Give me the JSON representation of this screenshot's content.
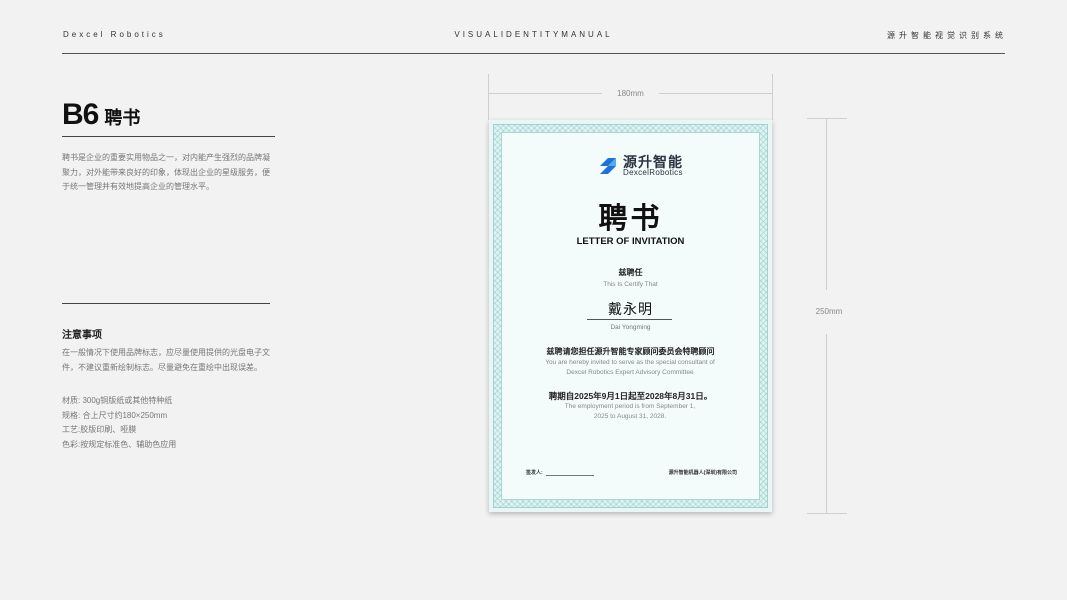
{
  "header": {
    "brand": "Dexcel Robotics",
    "manual": "VISUALIDENTITYMANUAL",
    "system": "源升智能视觉识别系统"
  },
  "section": {
    "code": "B6",
    "title": "聘书",
    "description": "聘书是企业的重要实用物品之一，对内能产生强烈的品牌凝聚力，对外能带来良好的印象，体现出企业的星级服务，便于统一管理并有效地提高企业的管理水平。"
  },
  "notes": {
    "title": "注意事项",
    "text": "在一般情况下使用品牌标志，应尽量使用提供的光盘电子文件，不建议重新绘制标志。尽量避免在重绘中出现误差。"
  },
  "specs": [
    "材质: 300g铜版纸或其他特种纸",
    "规格: 合上尺寸约180×250mm",
    "工艺:胶版印刷、哑膜",
    "色彩:按规定标准色、辅助色应用"
  ],
  "dimensions": {
    "width": "180mm",
    "height": "250mm"
  },
  "certificate": {
    "logo_zh": "源升智能",
    "logo_en": "DexcelRobotics",
    "title_zh": "聘书",
    "title_en": "LETTER OF INVITATION",
    "hire_zh": "兹聘任",
    "hire_en": "This Is Certify That",
    "name_zh": "戴永明",
    "name_en": "Dai Yongming",
    "role_zh": "兹聘请您担任源升智能专家顾问委员会特聘顾问",
    "role_en": "You are hereby invited to serve as the special consultant of Dexcel Robotics Expert Advisory Committee",
    "term_zh": "聘期自2025年9月1日起至2028年8月31日。",
    "term_en": "The employment period is from September 1, 2025 to August 31, 2028.",
    "signer_label": "签发人:",
    "company": "源升智能机器人(深圳)有限公司"
  },
  "colors": {
    "cert_background": "#eaf6f5",
    "cert_border": "#9fd3cf",
    "logo_blue": "#1e73d8",
    "page_background": "#f2f2f2"
  }
}
